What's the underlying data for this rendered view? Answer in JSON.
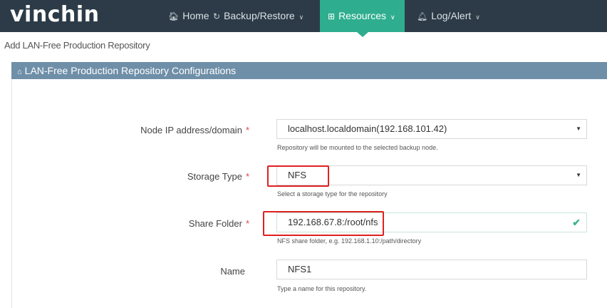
{
  "brand": {
    "logo": "vinchin"
  },
  "nav": {
    "items": [
      {
        "label": "Home",
        "icon": "home-icon"
      },
      {
        "label": "Backup/Restore",
        "icon": "refresh-icon"
      },
      {
        "label": "Resources",
        "icon": "grid-icon"
      },
      {
        "label": "Log/Alert",
        "icon": "bell-icon"
      }
    ],
    "active": "Resources",
    "accent_color": "#2fae8f",
    "bar_color": "#2c3b47"
  },
  "breadcrumb": "Add LAN-Free Production Repository",
  "panel": {
    "title": "LAN-Free Production Repository Configurations",
    "header_color": "#6f8fa8"
  },
  "form": {
    "node": {
      "label": "Node IP address/domain",
      "required": "*",
      "value": "localhost.localdomain(192.168.101.42)",
      "help": "Repository will be mounted to the selected backup node."
    },
    "storage_type": {
      "label": "Storage Type",
      "required": "*",
      "value": "NFS",
      "help": "Select a storage type for the repository"
    },
    "share_folder": {
      "label": "Share Folder",
      "required": "*",
      "value": "192.168.67.8:/root/nfs",
      "help": "NFS share folder, e.g. 192.168.1.10:/path/directory"
    },
    "name": {
      "label": "Name",
      "value": "NFS1",
      "help": "Type a name for this repository."
    }
  }
}
